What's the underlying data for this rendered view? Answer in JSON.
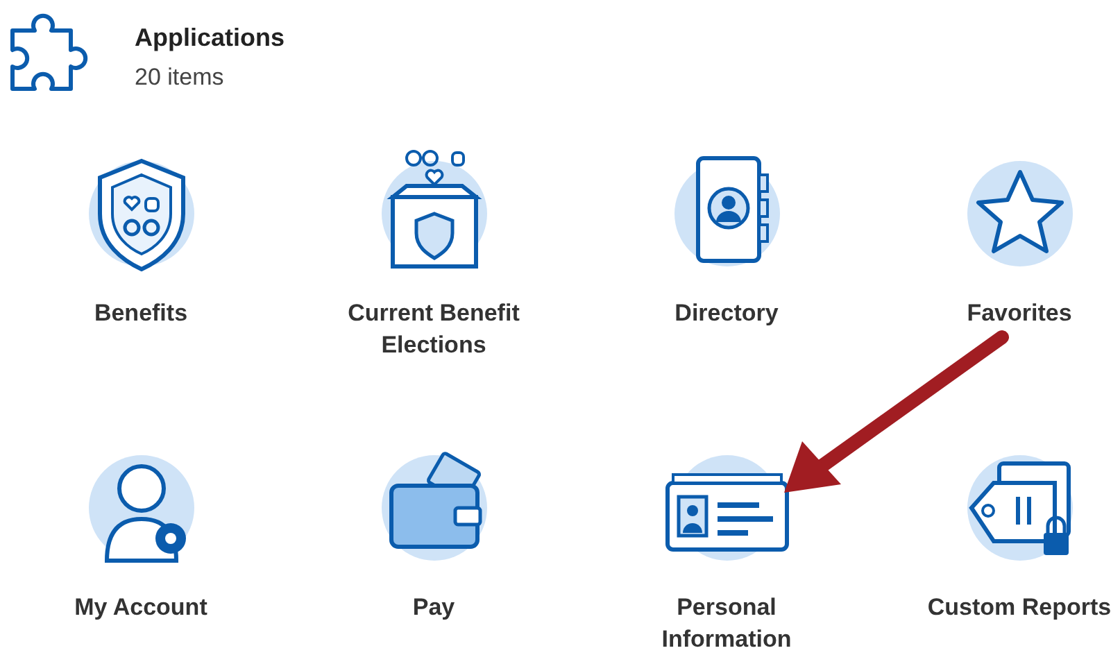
{
  "header": {
    "title": "Applications",
    "count": "20 items"
  },
  "apps": [
    {
      "label": "Benefits"
    },
    {
      "label": "Current Benefit Elections"
    },
    {
      "label": "Directory"
    },
    {
      "label": "Favorites"
    },
    {
      "label": "My Account"
    },
    {
      "label": "Pay"
    },
    {
      "label": "Personal Information"
    },
    {
      "label": "Custom Reports"
    }
  ],
  "annotation": {
    "kind": "arrow",
    "color": "#a11d22"
  }
}
